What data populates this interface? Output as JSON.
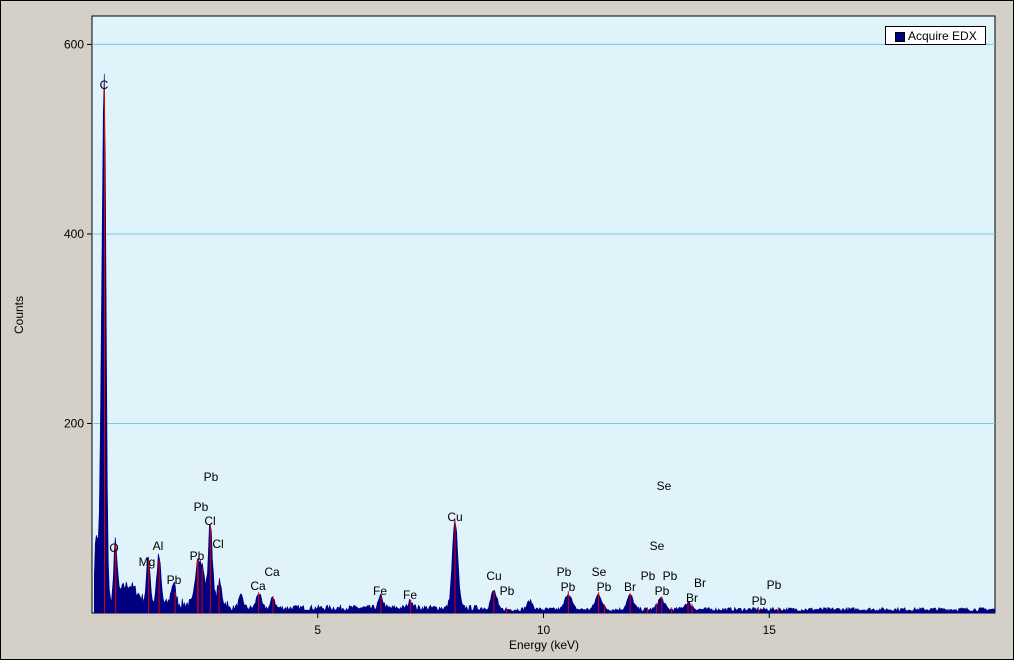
{
  "chart_data": {
    "type": "area",
    "xlabel": "Energy (keV)",
    "ylabel": "Counts",
    "xlim": [
      0,
      20
    ],
    "ylim": [
      0,
      630
    ],
    "x_ticks": [
      5,
      10,
      15
    ],
    "y_ticks": [
      200,
      400,
      600
    ],
    "grid": "horizontal",
    "legend_position": "top-right",
    "series": [
      {
        "name": "Acquire EDX",
        "color": "#000080",
        "baseline": 6,
        "peaks": [
          {
            "x": 0.1,
            "y": 75,
            "w": 0.04
          },
          {
            "x": 0.2,
            "y": 140,
            "w": 0.03
          },
          {
            "x": 0.27,
            "y": 549,
            "w": 0.04
          },
          {
            "x": 0.52,
            "y": 60,
            "w": 0.035
          },
          {
            "x": 0.8,
            "y": 20,
            "w": 0.2
          },
          {
            "x": 1.25,
            "y": 48,
            "w": 0.04
          },
          {
            "x": 1.48,
            "y": 50,
            "w": 0.045
          },
          {
            "x": 1.8,
            "y": 22,
            "w": 0.05
          },
          {
            "x": 2.34,
            "y": 48,
            "w": 0.05
          },
          {
            "x": 2.45,
            "y": 35,
            "w": 0.05
          },
          {
            "x": 2.62,
            "y": 87,
            "w": 0.045
          },
          {
            "x": 2.82,
            "y": 22,
            "w": 0.05
          },
          {
            "x": 3.3,
            "y": 12,
            "w": 0.05
          },
          {
            "x": 3.69,
            "y": 16,
            "w": 0.05
          },
          {
            "x": 4.01,
            "y": 12,
            "w": 0.04
          },
          {
            "x": 6.4,
            "y": 12,
            "w": 0.05
          },
          {
            "x": 7.06,
            "y": 8,
            "w": 0.05
          },
          {
            "x": 8.04,
            "y": 92,
            "w": 0.06
          },
          {
            "x": 8.9,
            "y": 18,
            "w": 0.06
          },
          {
            "x": 9.7,
            "y": 9,
            "w": 0.06
          },
          {
            "x": 10.55,
            "y": 17,
            "w": 0.07
          },
          {
            "x": 11.22,
            "y": 16,
            "w": 0.07
          },
          {
            "x": 11.92,
            "y": 15,
            "w": 0.07
          },
          {
            "x": 12.6,
            "y": 12,
            "w": 0.07
          },
          {
            "x": 13.2,
            "y": 7,
            "w": 0.08
          }
        ]
      }
    ],
    "element_lines": [
      {
        "label": "C",
        "x": 0.277
      },
      {
        "label": "O",
        "x": 0.525
      },
      {
        "label": "Mg",
        "x": 1.254
      },
      {
        "label": "Al",
        "x": 1.487
      },
      {
        "label": "Pb",
        "x": 1.84
      },
      {
        "label": "Pb",
        "x": 2.34
      },
      {
        "label": "Pb",
        "x": 2.44
      },
      {
        "label": "Pb",
        "x": 2.35
      },
      {
        "label": "Cl",
        "x": 2.62
      },
      {
        "label": "Cl",
        "x": 2.815
      },
      {
        "label": "Ca",
        "x": 3.69
      },
      {
        "label": "Ca",
        "x": 4.01
      },
      {
        "label": "Fe",
        "x": 6.4
      },
      {
        "label": "Fe",
        "x": 7.06
      },
      {
        "label": "Cu",
        "x": 8.04
      },
      {
        "label": "Cu",
        "x": 8.9
      },
      {
        "label": "Pb",
        "x": 9.18
      },
      {
        "label": "Pb",
        "x": 10.55
      },
      {
        "label": "Pb",
        "x": 10.55
      },
      {
        "label": "Se",
        "x": 11.22
      },
      {
        "label": "Pb",
        "x": 11.35
      },
      {
        "label": "Br",
        "x": 11.92
      },
      {
        "label": "Pb",
        "x": 12.3
      },
      {
        "label": "Pb",
        "x": 12.62
      },
      {
        "label": "Pb",
        "x": 12.84
      },
      {
        "label": "Se",
        "x": 12.5
      },
      {
        "label": "Se",
        "x": 12.5
      },
      {
        "label": "Br",
        "x": 13.29
      },
      {
        "label": "Br",
        "x": 13.2
      },
      {
        "label": "Pb",
        "x": 14.76
      },
      {
        "label": "Pb",
        "x": 15.2
      }
    ]
  }
}
